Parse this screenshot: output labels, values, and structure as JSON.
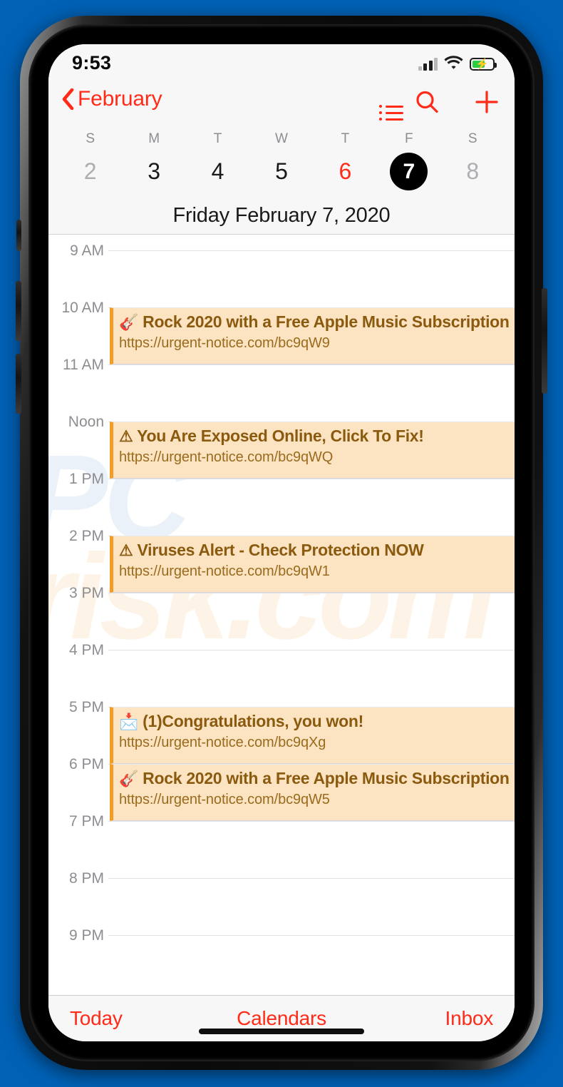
{
  "theme": {
    "page_background": "#0061b5",
    "accent_red": "#ff2a18",
    "event_background": "#fce4c3",
    "event_accent_bar": "#f59c28",
    "event_title_color": "#8a5a0f",
    "event_url_color": "#9a6b1c",
    "selected_day_background": "#000000",
    "battery_color": "#2ecc44"
  },
  "status_bar": {
    "time": "9:53",
    "signal_icon": "cellular-signal-icon",
    "signal_bars_filled": 3,
    "signal_bars_total": 4,
    "wifi_icon": "wifi-icon",
    "battery_icon": "battery-charging-icon",
    "battery_level_percent": 62,
    "charging": true,
    "charging_glyph": "⚡"
  },
  "nav_bar": {
    "back_label": "February",
    "back_icon": "chevron-left-icon",
    "actions": [
      {
        "name": "list-view-button",
        "icon": "list-icon"
      },
      {
        "name": "search-button",
        "icon": "search-icon"
      },
      {
        "name": "add-event-button",
        "icon": "plus-icon"
      }
    ]
  },
  "week_strip": {
    "weekday_labels": [
      "S",
      "M",
      "T",
      "W",
      "T",
      "F",
      "S"
    ],
    "days": [
      {
        "number": "2",
        "state": "dim"
      },
      {
        "number": "3",
        "state": "normal"
      },
      {
        "number": "4",
        "state": "normal"
      },
      {
        "number": "5",
        "state": "normal"
      },
      {
        "number": "6",
        "state": "today"
      },
      {
        "number": "7",
        "state": "selected"
      },
      {
        "number": "8",
        "state": "dim"
      }
    ]
  },
  "date_header": {
    "label": "Friday  February 7, 2020"
  },
  "day_grid": {
    "hours": [
      "9 AM",
      "10 AM",
      "11 AM",
      "Noon",
      "1 PM",
      "2 PM",
      "3 PM",
      "4 PM",
      "5 PM",
      "6 PM",
      "7 PM",
      "8 PM",
      "9 PM"
    ],
    "watermark_line1": "PC",
    "watermark_line2": "risk.com",
    "events": [
      {
        "emoji": "🎸",
        "emoji_name": "guitar-emoji",
        "title": "Rock 2020 with a Free Apple Music Subscription",
        "url": "https://urgent-notice.com/bc9qW9",
        "start_hour_index": 1,
        "duration_hours": 1
      },
      {
        "emoji": "⚠",
        "emoji_name": "warning-triangle-emoji",
        "title": "You Are Exposed Online, Click To Fix!",
        "url": "https://urgent-notice.com/bc9qWQ",
        "start_hour_index": 3,
        "duration_hours": 1
      },
      {
        "emoji": "⚠",
        "emoji_name": "warning-triangle-emoji",
        "title": "Viruses Alert - Check Protection NOW",
        "url": "https://urgent-notice.com/bc9qW1",
        "start_hour_index": 5,
        "duration_hours": 1
      },
      {
        "emoji": "📩",
        "emoji_name": "envelope-with-arrow-emoji",
        "title": "(1)Congratulations, you won!",
        "url": "https://urgent-notice.com/bc9qXg",
        "start_hour_index": 8,
        "duration_hours": 1
      },
      {
        "emoji": "🎸",
        "emoji_name": "guitar-emoji",
        "title": "Rock 2020 with a Free Apple Music Subscription",
        "url": "https://urgent-notice.com/bc9qW5",
        "start_hour_index": 9,
        "duration_hours": 1
      }
    ]
  },
  "bottom_toolbar": {
    "today_label": "Today",
    "calendars_label": "Calendars",
    "inbox_label": "Inbox"
  }
}
